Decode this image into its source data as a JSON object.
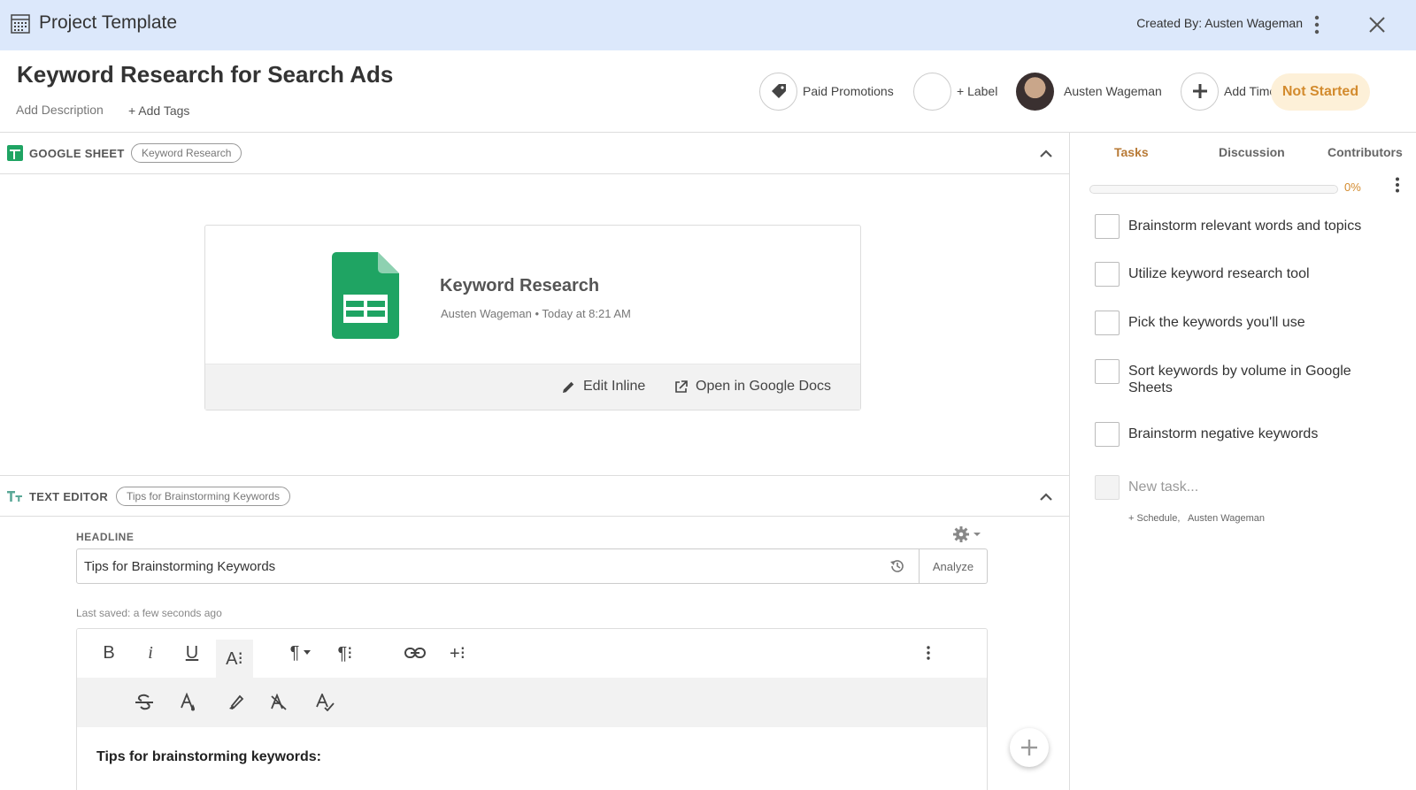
{
  "topbar": {
    "title": "Project Template",
    "created_by": "Created By: Austen Wageman"
  },
  "header": {
    "project_title": "Keyword Research for Search Ads",
    "add_description": "Add Description",
    "add_tags": "+ Add Tags",
    "category_label": "Paid Promotions",
    "label_label": "+ Label",
    "assignee_name": "Austen Wageman",
    "add_time_label": "Add Time",
    "status": "Not Started",
    "status_color": "#d38b2e"
  },
  "google_sheet": {
    "section_name": "GOOGLE SHEET",
    "pill": "Keyword Research",
    "file_name": "Keyword Research",
    "file_owner": "Austen Wageman",
    "file_time": "• Today at 8:21 AM",
    "edit_inline": "Edit Inline",
    "open_docs": "Open in Google Docs",
    "icon_color": "#1fa463"
  },
  "text_editor": {
    "section_name": "TEXT EDITOR",
    "pill": "Tips for Brainstorming Keywords",
    "headline_label": "HEADLINE",
    "headline_value": "Tips for Brainstorming Keywords",
    "analyze_label": "Analyze",
    "last_saved": "Last saved: a few seconds ago",
    "toolbar": {
      "bold": "B",
      "italic": "i",
      "underline": "U",
      "font_size": "A⁝",
      "paragraph": "¶",
      "paragraph_format": "¶⁝",
      "insert_more": "+⁝"
    },
    "content_heading": "Tips for brainstorming keywords:"
  },
  "sidebar": {
    "tabs": [
      {
        "label": "Tasks"
      },
      {
        "label": "Discussion"
      },
      {
        "label": "Contributors"
      }
    ],
    "progress_percent": 0,
    "progress_label": "0%",
    "tasks": [
      {
        "text": "Brainstorm relevant words and topics"
      },
      {
        "text": "Utilize keyword research tool"
      },
      {
        "text": "Pick the keywords you'll use"
      },
      {
        "text": "Sort keywords by volume in Google Sheets"
      },
      {
        "text": "Brainstorm negative keywords"
      }
    ],
    "new_task_placeholder": "New task...",
    "new_task_meta": "+ Schedule,   Austen Wageman"
  },
  "colors": {
    "topbar_bg": "#dce8fb",
    "accent": "#b87a36"
  }
}
